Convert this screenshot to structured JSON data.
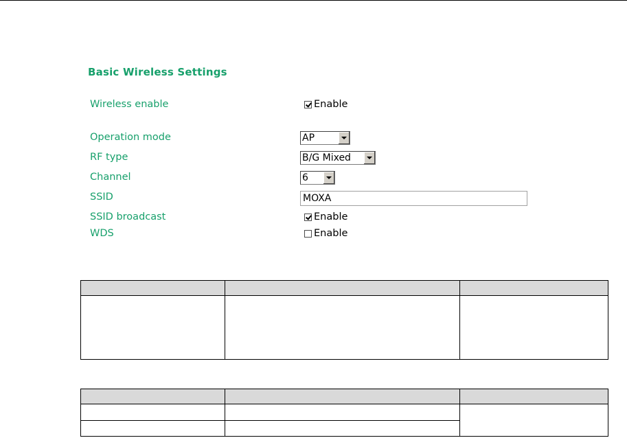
{
  "title": "Basic Wireless Settings",
  "fields": {
    "wireless_enable": {
      "label": "Wireless enable",
      "checked": true,
      "option_label": "Enable"
    },
    "operation_mode": {
      "label": "Operation mode",
      "value": "AP"
    },
    "rf_type": {
      "label": "RF type",
      "value": "B/G Mixed"
    },
    "channel": {
      "label": "Channel",
      "value": "6"
    },
    "ssid": {
      "label": "SSID",
      "value": "MOXA"
    },
    "ssid_broadcast": {
      "label": "SSID broadcast",
      "checked": true,
      "option_label": "Enable"
    },
    "wds": {
      "label": "WDS",
      "checked": false,
      "option_label": "Enable"
    }
  },
  "tables": [
    {
      "header": [
        "",
        "",
        ""
      ],
      "rows": [
        [
          "",
          "",
          ""
        ]
      ]
    },
    {
      "header": [
        "",
        "",
        ""
      ],
      "rows": [
        [
          "",
          "",
          ""
        ],
        [
          "",
          ""
        ]
      ]
    }
  ],
  "colors": {
    "accent": "#17a06b",
    "table_header": "#d9d9d9"
  }
}
